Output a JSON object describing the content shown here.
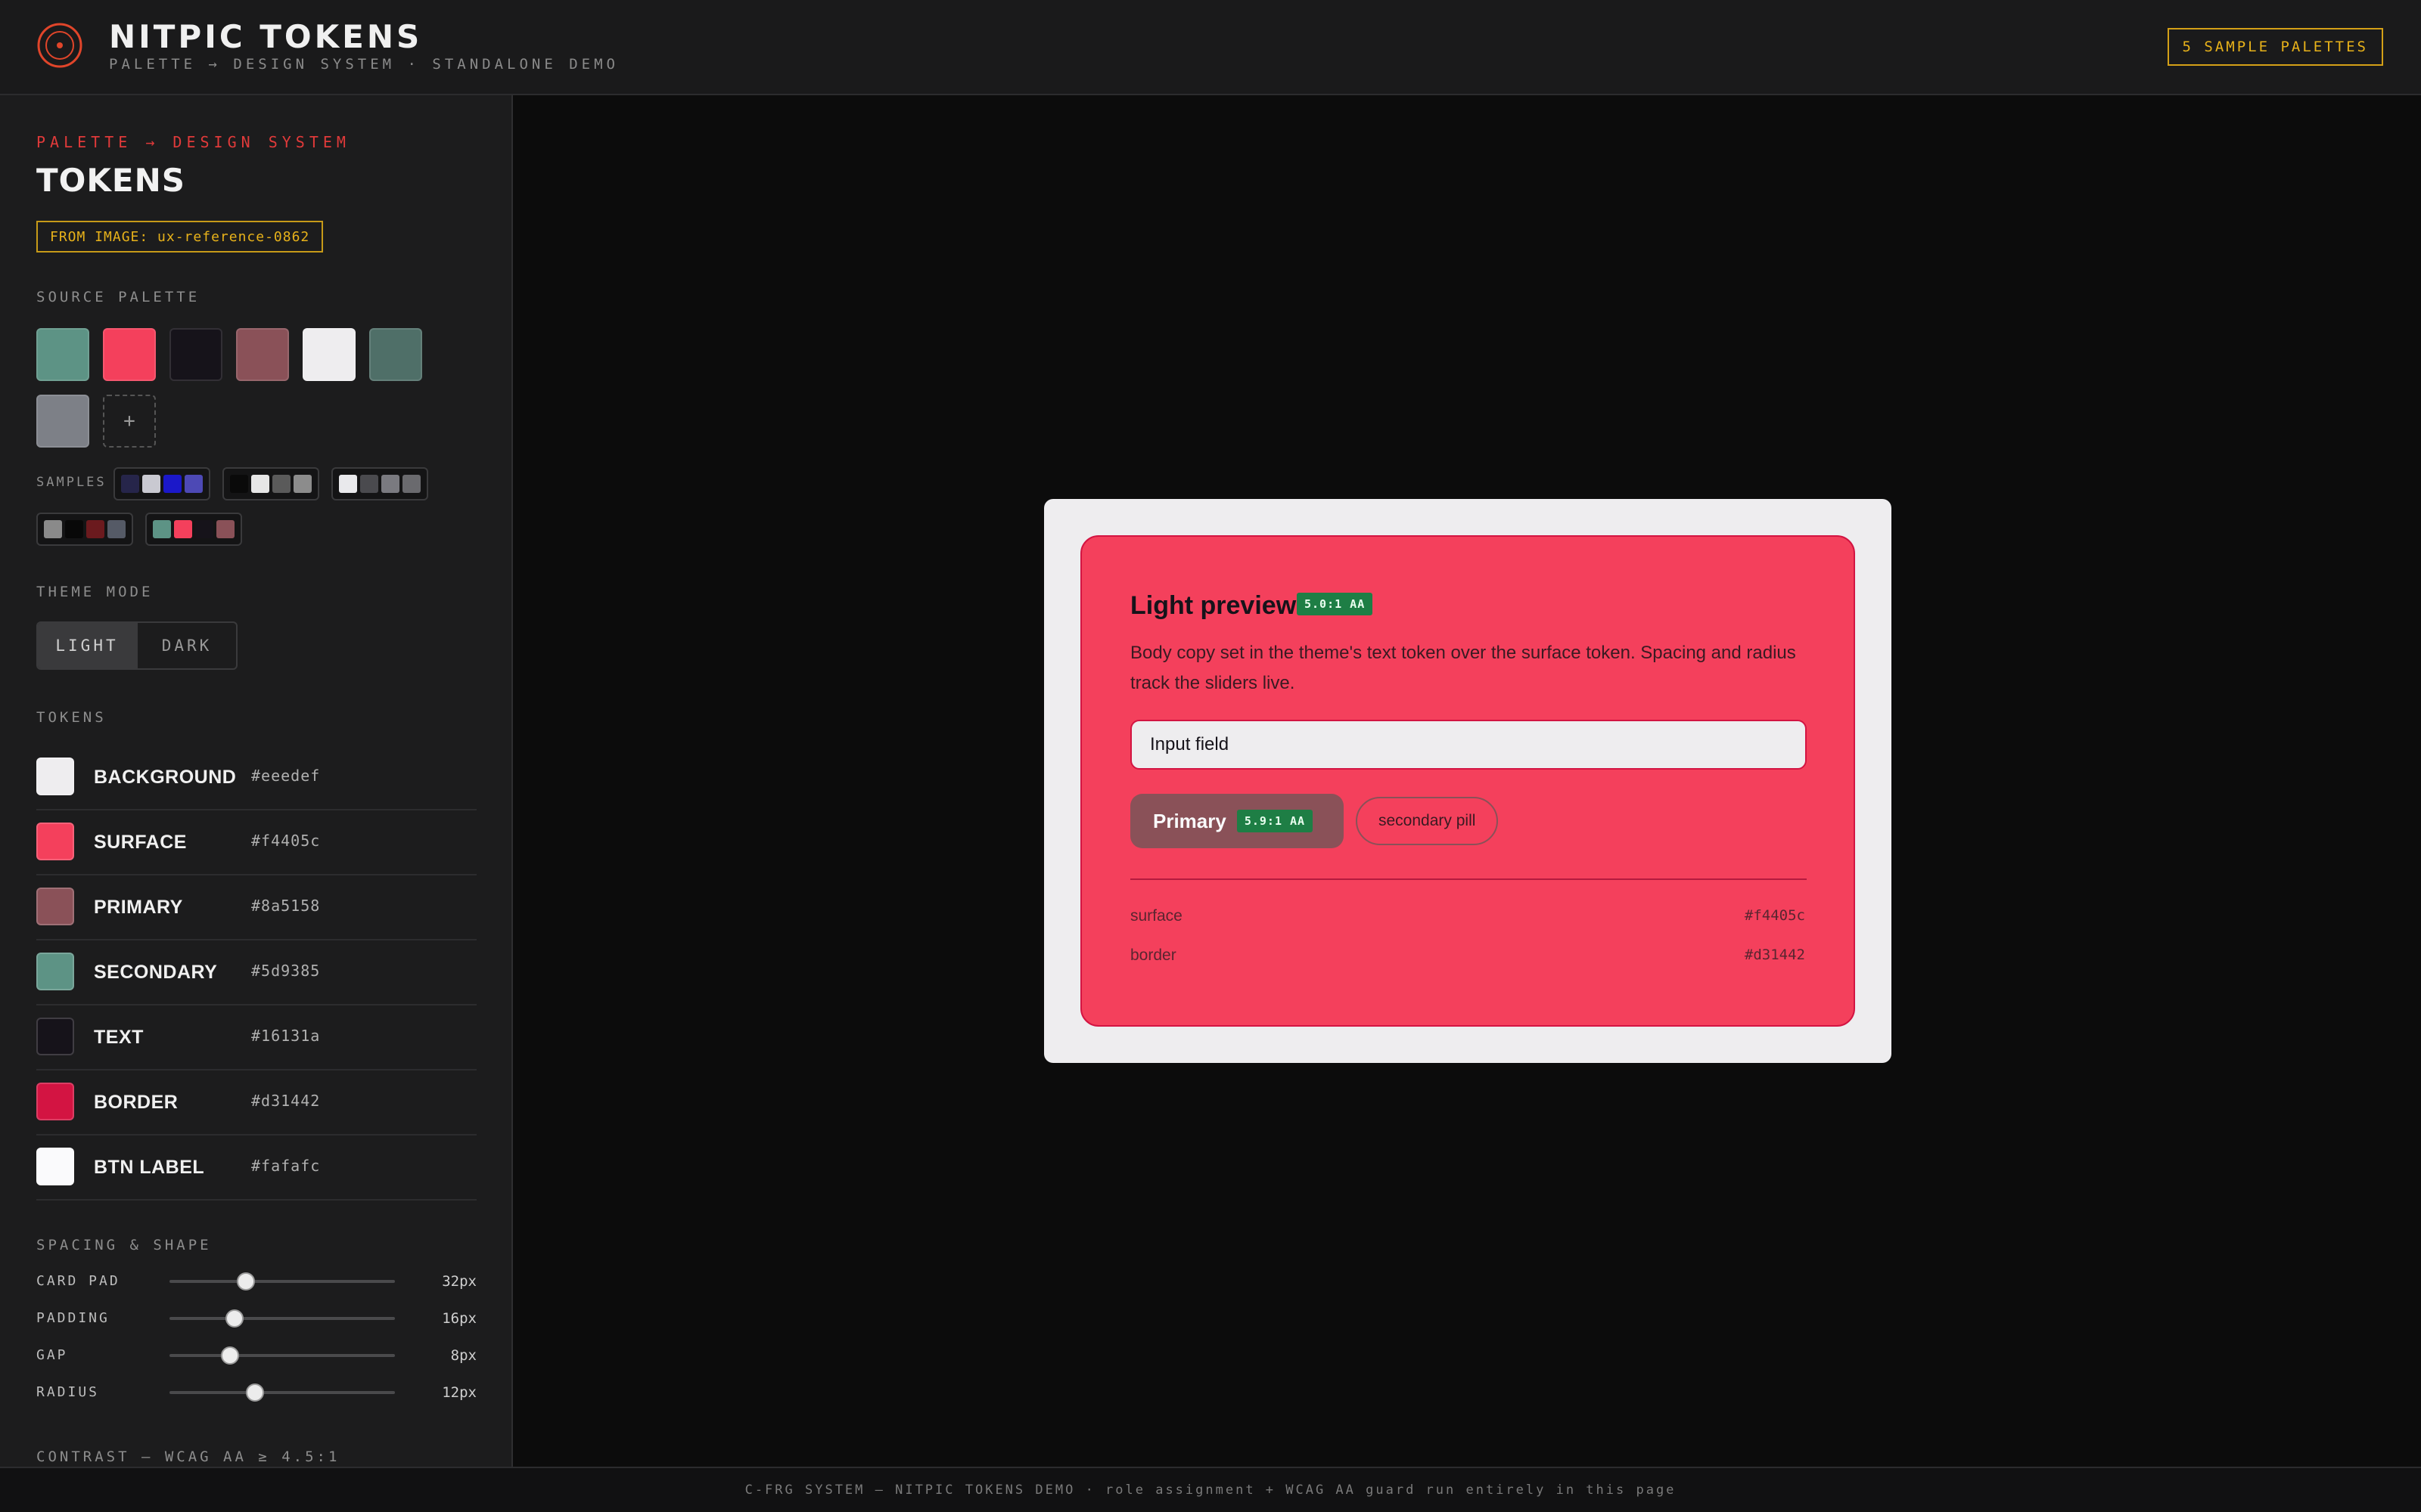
{
  "header": {
    "title": "NITPIC TOKENS",
    "subtitle": "PALETTE → DESIGN SYSTEM · STANDALONE DEMO",
    "samples_button": "5 SAMPLE PALETTES",
    "logo_icon": "target-icon"
  },
  "sidebar": {
    "eyebrow": "PALETTE → DESIGN SYSTEM",
    "title": "TOKENS",
    "from_badge": "FROM IMAGE: ux-reference-0862",
    "source_label": "SOURCE PALETTE",
    "source_swatches": [
      "#5d9385",
      "#f4405c",
      "#16131a",
      "#8a5158",
      "#eeedef",
      "#4f6f68",
      "#7d8087"
    ],
    "add_swatch": "+",
    "samples_label": "SAMPLES",
    "sample_palettes": [
      [
        "#26254a",
        "#c9c9d1",
        "#1b18c9",
        "#4d49b5"
      ],
      [
        "#0a0a0a",
        "#e6e6e6",
        "#5a5a5a",
        "#8c8c8c"
      ],
      [
        "#e9e9ec",
        "#4a4a4e",
        "#7a7a80",
        "#6a6a6e"
      ],
      [
        "#8a8a8a",
        "#080808",
        "#6b1a1e",
        "#555a66"
      ],
      [
        "#5d9385",
        "#f4405c",
        "#16131a",
        "#8a5158"
      ]
    ],
    "theme_label": "THEME MODE",
    "theme_light": "LIGHT",
    "theme_dark": "DARK",
    "tokens_label": "TOKENS",
    "tokens": [
      {
        "name": "BACKGROUND",
        "hex": "#eeedef"
      },
      {
        "name": "SURFACE",
        "hex": "#f4405c"
      },
      {
        "name": "PRIMARY",
        "hex": "#8a5158"
      },
      {
        "name": "SECONDARY",
        "hex": "#5d9385"
      },
      {
        "name": "TEXT",
        "hex": "#16131a"
      },
      {
        "name": "BORDER",
        "hex": "#d31442"
      },
      {
        "name": "BTN LABEL",
        "hex": "#fafafc"
      }
    ],
    "spacing_label": "SPACING & SHAPE",
    "sliders": [
      {
        "label": "CARD PAD",
        "value": "32px",
        "fraction": 0.34
      },
      {
        "label": "PADDING",
        "value": "16px",
        "fraction": 0.29
      },
      {
        "label": "GAP",
        "value": "8px",
        "fraction": 0.27
      },
      {
        "label": "RADIUS",
        "value": "12px",
        "fraction": 0.38
      }
    ],
    "contrast_label": "CONTRAST — WCAG AA ≥ 4.5:1"
  },
  "preview": {
    "title": "Light preview",
    "title_badge": "5.0:1 AA",
    "body": "Body copy set in the theme's text token over the surface token. Spacing and radius track the sliders live.",
    "input_value": "Input field",
    "primary_label": "Primary",
    "primary_badge": "5.9:1 AA",
    "secondary_label": "secondary pill",
    "meta": [
      {
        "label": "surface",
        "value": "#f4405c"
      },
      {
        "label": "border",
        "value": "#d31442"
      }
    ]
  },
  "footer": {
    "text": "C-FRG SYSTEM — NITPIC TOKENS DEMO · role assignment + WCAG AA guard run entirely in this page"
  }
}
